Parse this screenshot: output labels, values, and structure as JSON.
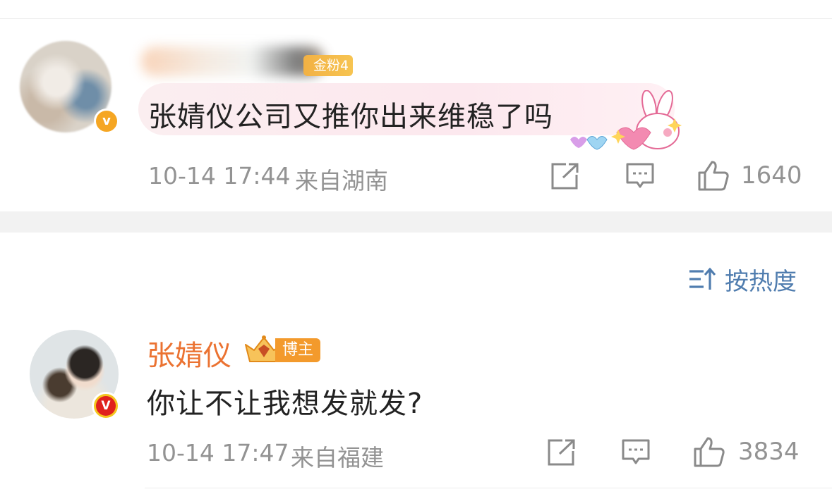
{
  "comments": [
    {
      "badge": "金粉4",
      "text": "张婧仪公司又推你出来维稳了吗",
      "verified_mark": "v",
      "time": "10-14 17:44",
      "location": "来自湖南",
      "likes": "1640",
      "icons": [
        "share-icon",
        "comment-icon",
        "like-icon"
      ]
    },
    {
      "username": "张婧仪",
      "badge": "博主",
      "verified_mark": "V",
      "text": "你让不让我想发就发?",
      "time": "10-14 17:47",
      "location": "来自福建",
      "likes": "3834",
      "icons": [
        "share-icon",
        "comment-icon",
        "like-icon"
      ]
    }
  ],
  "sort": {
    "label": "按热度",
    "icon": "sort-icon"
  },
  "colors": {
    "name_orange": "#eb7231",
    "link_blue": "#507daf",
    "meta_gray": "#939393",
    "badge_gold": "#f5a623"
  }
}
